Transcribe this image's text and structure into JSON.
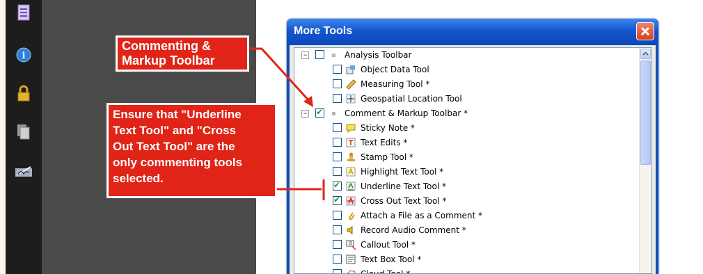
{
  "dialog": {
    "title": "More Tools",
    "close_label": "✕"
  },
  "tree": [
    {
      "type": "group",
      "label": "Analysis Toolbar",
      "expander": "⊟",
      "checked": false,
      "indent": 0
    },
    {
      "type": "tool",
      "label": "Object Data Tool",
      "checked": false,
      "icon": "object-data-icon"
    },
    {
      "type": "tool",
      "label": "Measuring Tool *",
      "checked": false,
      "icon": "ruler-icon"
    },
    {
      "type": "tool",
      "label": "Geospatial Location Tool",
      "checked": false,
      "icon": "geospatial-icon"
    },
    {
      "type": "group",
      "label": "Comment & Markup Toolbar *",
      "expander": "⊟",
      "checked": true,
      "indent": 0
    },
    {
      "type": "tool",
      "label": "Sticky Note *",
      "checked": false,
      "icon": "sticky-note-icon"
    },
    {
      "type": "tool",
      "label": "Text Edits *",
      "checked": false,
      "icon": "text-edits-icon"
    },
    {
      "type": "tool",
      "label": "Stamp Tool *",
      "checked": false,
      "icon": "stamp-icon"
    },
    {
      "type": "tool",
      "label": "Highlight Text Tool *",
      "checked": false,
      "icon": "highlight-icon"
    },
    {
      "type": "tool",
      "label": "Underline Text Tool *",
      "checked": true,
      "icon": "underline-icon"
    },
    {
      "type": "tool",
      "label": "Cross Out Text Tool *",
      "checked": true,
      "icon": "cross-out-icon"
    },
    {
      "type": "tool",
      "label": "Attach a File as a Comment *",
      "checked": false,
      "icon": "attach-file-icon"
    },
    {
      "type": "tool",
      "label": "Record Audio Comment *",
      "checked": false,
      "icon": "audio-icon"
    },
    {
      "type": "tool",
      "label": "Callout Tool *",
      "checked": false,
      "icon": "callout-icon"
    },
    {
      "type": "tool",
      "label": "Text Box Tool *",
      "checked": false,
      "icon": "text-box-icon"
    },
    {
      "type": "tool",
      "label": "Cloud Tool *",
      "checked": false,
      "icon": "cloud-icon"
    }
  ],
  "callouts": {
    "commenting": "Commenting &\nMarkup Toolbar",
    "ensure": "Ensure that \"Underline\nText Tool\" and \"Cross\nOut Text Tool\" are the\nonly commenting tools\nselected."
  },
  "sidebar_icons": [
    "pages-icon",
    "info-icon",
    "lock-icon",
    "attachments-icon",
    "signature-icon"
  ],
  "colors": {
    "annotation_red": "#e02418",
    "dialog_blue": "#1556cf",
    "check_green": "#21a121"
  }
}
